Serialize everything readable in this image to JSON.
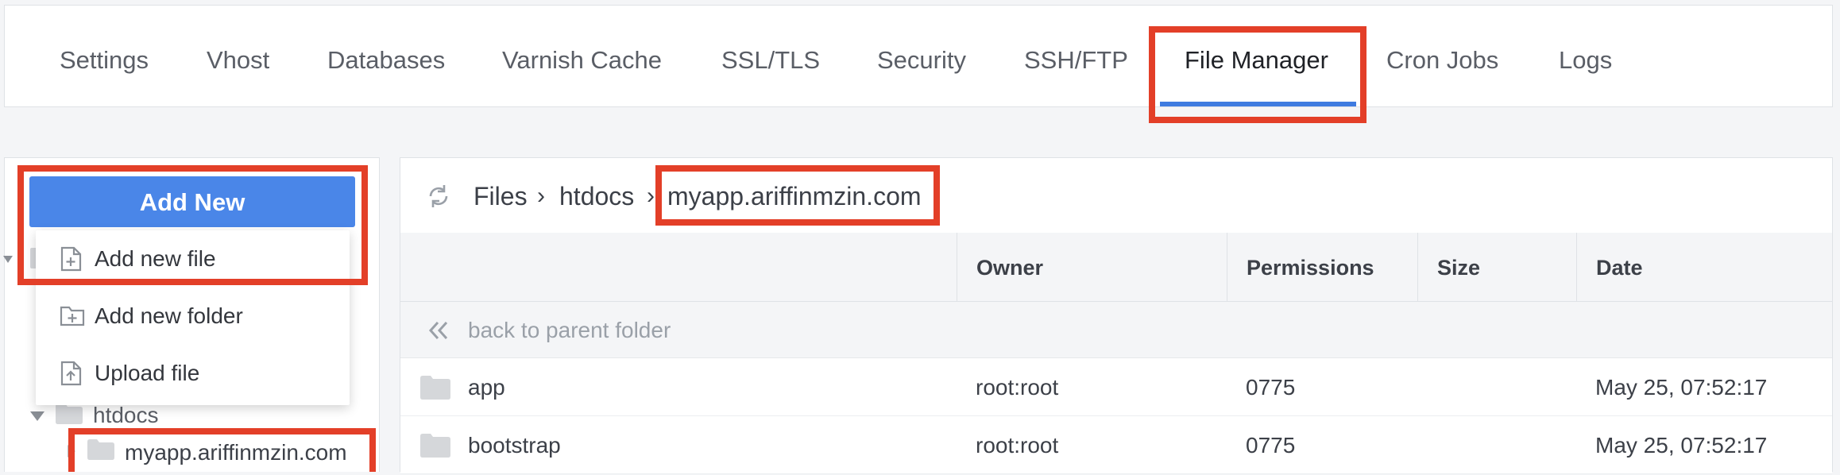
{
  "tabs": [
    {
      "label": "Settings",
      "active": false
    },
    {
      "label": "Vhost",
      "active": false
    },
    {
      "label": "Databases",
      "active": false
    },
    {
      "label": "Varnish Cache",
      "active": false
    },
    {
      "label": "SSL/TLS",
      "active": false
    },
    {
      "label": "Security",
      "active": false
    },
    {
      "label": "SSH/FTP",
      "active": false
    },
    {
      "label": "File Manager",
      "active": true
    },
    {
      "label": "Cron Jobs",
      "active": false
    },
    {
      "label": "Logs",
      "active": false
    }
  ],
  "sidebar": {
    "add_new_label": "Add New",
    "menu": [
      {
        "label": "Add new file",
        "icon": "file-plus-icon"
      },
      {
        "label": "Add new folder",
        "icon": "folder-plus-icon"
      },
      {
        "label": "Upload file",
        "icon": "file-upload-icon"
      }
    ],
    "tree": [
      {
        "label": "htdocs",
        "expanded": true
      },
      {
        "label": "myapp.ariffinmzin.com",
        "expanded": false
      }
    ]
  },
  "breadcrumb": {
    "refresh_icon": "refresh-icon",
    "items": [
      "Files",
      "htdocs",
      "myapp.ariffinmzin.com"
    ]
  },
  "table": {
    "columns": [
      "Owner",
      "Permissions",
      "Size",
      "Date"
    ],
    "back_label": "back to parent folder",
    "rows": [
      {
        "name": "app",
        "owner": "root:root",
        "permissions": "0775",
        "size": "",
        "date": "May 25, 07:52:17"
      },
      {
        "name": "bootstrap",
        "owner": "root:root",
        "permissions": "0775",
        "size": "",
        "date": "May 25, 07:52:17"
      }
    ]
  },
  "colors": {
    "accent": "#4a86e8",
    "highlight": "#e33f28",
    "tab_underline": "#3e7be0"
  }
}
